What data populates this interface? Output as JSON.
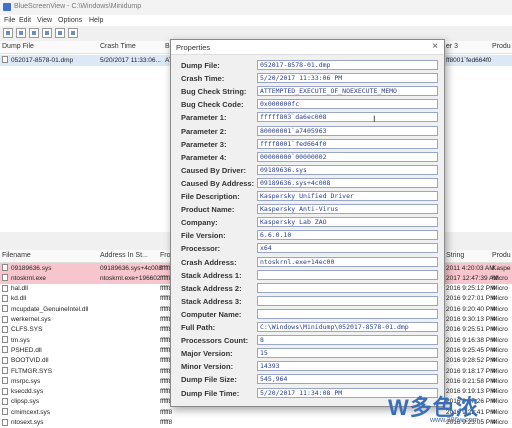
{
  "window": {
    "title": "BlueScreenView  -  C:\\Windows\\Minidump"
  },
  "menu": [
    "File",
    "Edit",
    "View",
    "Options",
    "Help"
  ],
  "top_list": {
    "columns": [
      "Dump File",
      "Crash Time",
      "Bu",
      "er 3",
      "Produ"
    ],
    "rows": [
      {
        "dump_file": "052017-8578-01.dmp",
        "crash_time": "5/20/2017 11:33:06...",
        "bug": "AT",
        "param3": "ff8001`fed664f0"
      }
    ]
  },
  "bottom_list": {
    "columns": [
      "Filename",
      "Address In St...",
      "From",
      "String",
      "Produ"
    ],
    "rows": [
      {
        "filename": "09189636.sys",
        "address": "09189636.sys+4c008",
        "from": "fffff8",
        "string": "2011 4:20:03 AM",
        "product": "Kaspe",
        "highlight": true
      },
      {
        "filename": "ntoskrnl.exe",
        "address": "ntoskrnl.exe+196602",
        "from": "fffff8",
        "string": "2017 12:47:39 AM",
        "product": "Micro",
        "highlight": true
      },
      {
        "filename": "hal.dll",
        "address": "",
        "from": "fffff8",
        "string": "2016 9:25:12 PM",
        "product": "Micro",
        "highlight": false
      },
      {
        "filename": "kd.dll",
        "address": "",
        "from": "fffff8",
        "string": "2016 9:27:01 PM",
        "product": "Micro",
        "highlight": false
      },
      {
        "filename": "mcupdate_GenuineIntel.dll",
        "address": "",
        "from": "fffff8",
        "string": "2016 9:20:40 PM",
        "product": "Micro",
        "highlight": false
      },
      {
        "filename": "werkernel.sys",
        "address": "",
        "from": "fffff8",
        "string": "2016 9:30:13 PM",
        "product": "Micro",
        "highlight": false
      },
      {
        "filename": "CLFS.SYS",
        "address": "",
        "from": "fffff8",
        "string": "2016 9:25:51 PM",
        "product": "Micro",
        "highlight": false
      },
      {
        "filename": "tm.sys",
        "address": "",
        "from": "fffff8",
        "string": "2016 9:16:38 PM",
        "product": "Micro",
        "highlight": false
      },
      {
        "filename": "PSHED.dll",
        "address": "",
        "from": "fffff8",
        "string": "2016 9:25:45 PM",
        "product": "Micro",
        "highlight": false
      },
      {
        "filename": "BOOTVID.dll",
        "address": "",
        "from": "fffff8",
        "string": "2016 9:28:52 PM",
        "product": "Micro",
        "highlight": false
      },
      {
        "filename": "FLTMGR.SYS",
        "address": "",
        "from": "fffff8",
        "string": "2016 9:18:17 PM",
        "product": "Micro",
        "highlight": false
      },
      {
        "filename": "msrpc.sys",
        "address": "",
        "from": "fffff8",
        "string": "2016 9:21:58 PM",
        "product": "Micro",
        "highlight": false
      },
      {
        "filename": "ksecdd.sys",
        "address": "",
        "from": "fffff8",
        "string": "2016 9:19:13 PM",
        "product": "Micro",
        "highlight": false
      },
      {
        "filename": "clipsp.sys",
        "address": "",
        "from": "fffff8",
        "string": "2016 9:17:26 PM",
        "product": "Micro",
        "highlight": false
      },
      {
        "filename": "cmimcext.sys",
        "address": "",
        "from": "fffff8",
        "string": "2016 9:22:41 PM",
        "product": "Micro",
        "highlight": false
      },
      {
        "filename": "ntosext.sys",
        "address": "",
        "from": "fffff8",
        "string": "2016 9:23:05 PM",
        "product": "Micro",
        "highlight": false
      }
    ]
  },
  "dialog": {
    "title": "Properties",
    "close": "×",
    "fields": [
      {
        "label": "Dump File:",
        "value": "052017-8578-01.dmp"
      },
      {
        "label": "Crash Time:",
        "value": "5/20/2017 11:33:06 PM"
      },
      {
        "label": "Bug Check String:",
        "value": "ATTEMPTED_EXECUTE_OF_NOEXECUTE_MEMO"
      },
      {
        "label": "Bug Check Code:",
        "value": "0x000000fc"
      },
      {
        "label": "Parameter 1:",
        "value": "fffff803`da6ec008"
      },
      {
        "label": "Parameter 2:",
        "value": "80000001`a7405963"
      },
      {
        "label": "Parameter 3:",
        "value": "ffff8001`fed664f0"
      },
      {
        "label": "Parameter 4:",
        "value": "00000000`00000002"
      },
      {
        "label": "Caused By Driver:",
        "value": "09189636.sys"
      },
      {
        "label": "Caused By Address:",
        "value": "09189636.sys+4c008"
      },
      {
        "label": "File Description:",
        "value": "Kaspersky Unified Driver"
      },
      {
        "label": "Product Name:",
        "value": "Kaspersky Anti-Virus"
      },
      {
        "label": "Company:",
        "value": "Kaspersky Lab ZAO"
      },
      {
        "label": "File Version:",
        "value": "6.6.0.10"
      },
      {
        "label": "Processor:",
        "value": "x64"
      },
      {
        "label": "Crash Address:",
        "value": "ntoskrnl.exe+14ec00"
      },
      {
        "label": "Stack Address 1:",
        "value": ""
      },
      {
        "label": "Stack Address 2:",
        "value": ""
      },
      {
        "label": "Stack Address 3:",
        "value": ""
      },
      {
        "label": "Computer Name:",
        "value": ""
      },
      {
        "label": "Full Path:",
        "value": "C:\\Windows\\Minidump\\052017-8578-01.dmp"
      },
      {
        "label": "Processors Count:",
        "value": "8"
      },
      {
        "label": "Major Version:",
        "value": "15"
      },
      {
        "label": "Minor Version:",
        "value": "14393"
      },
      {
        "label": "Dump File Size:",
        "value": "545,964"
      },
      {
        "label": "Dump File Time:",
        "value": "5/20/2017 11:34:08 PM"
      }
    ]
  },
  "watermark": {
    "text": "W多色浓",
    "url": "www.386w.com"
  }
}
